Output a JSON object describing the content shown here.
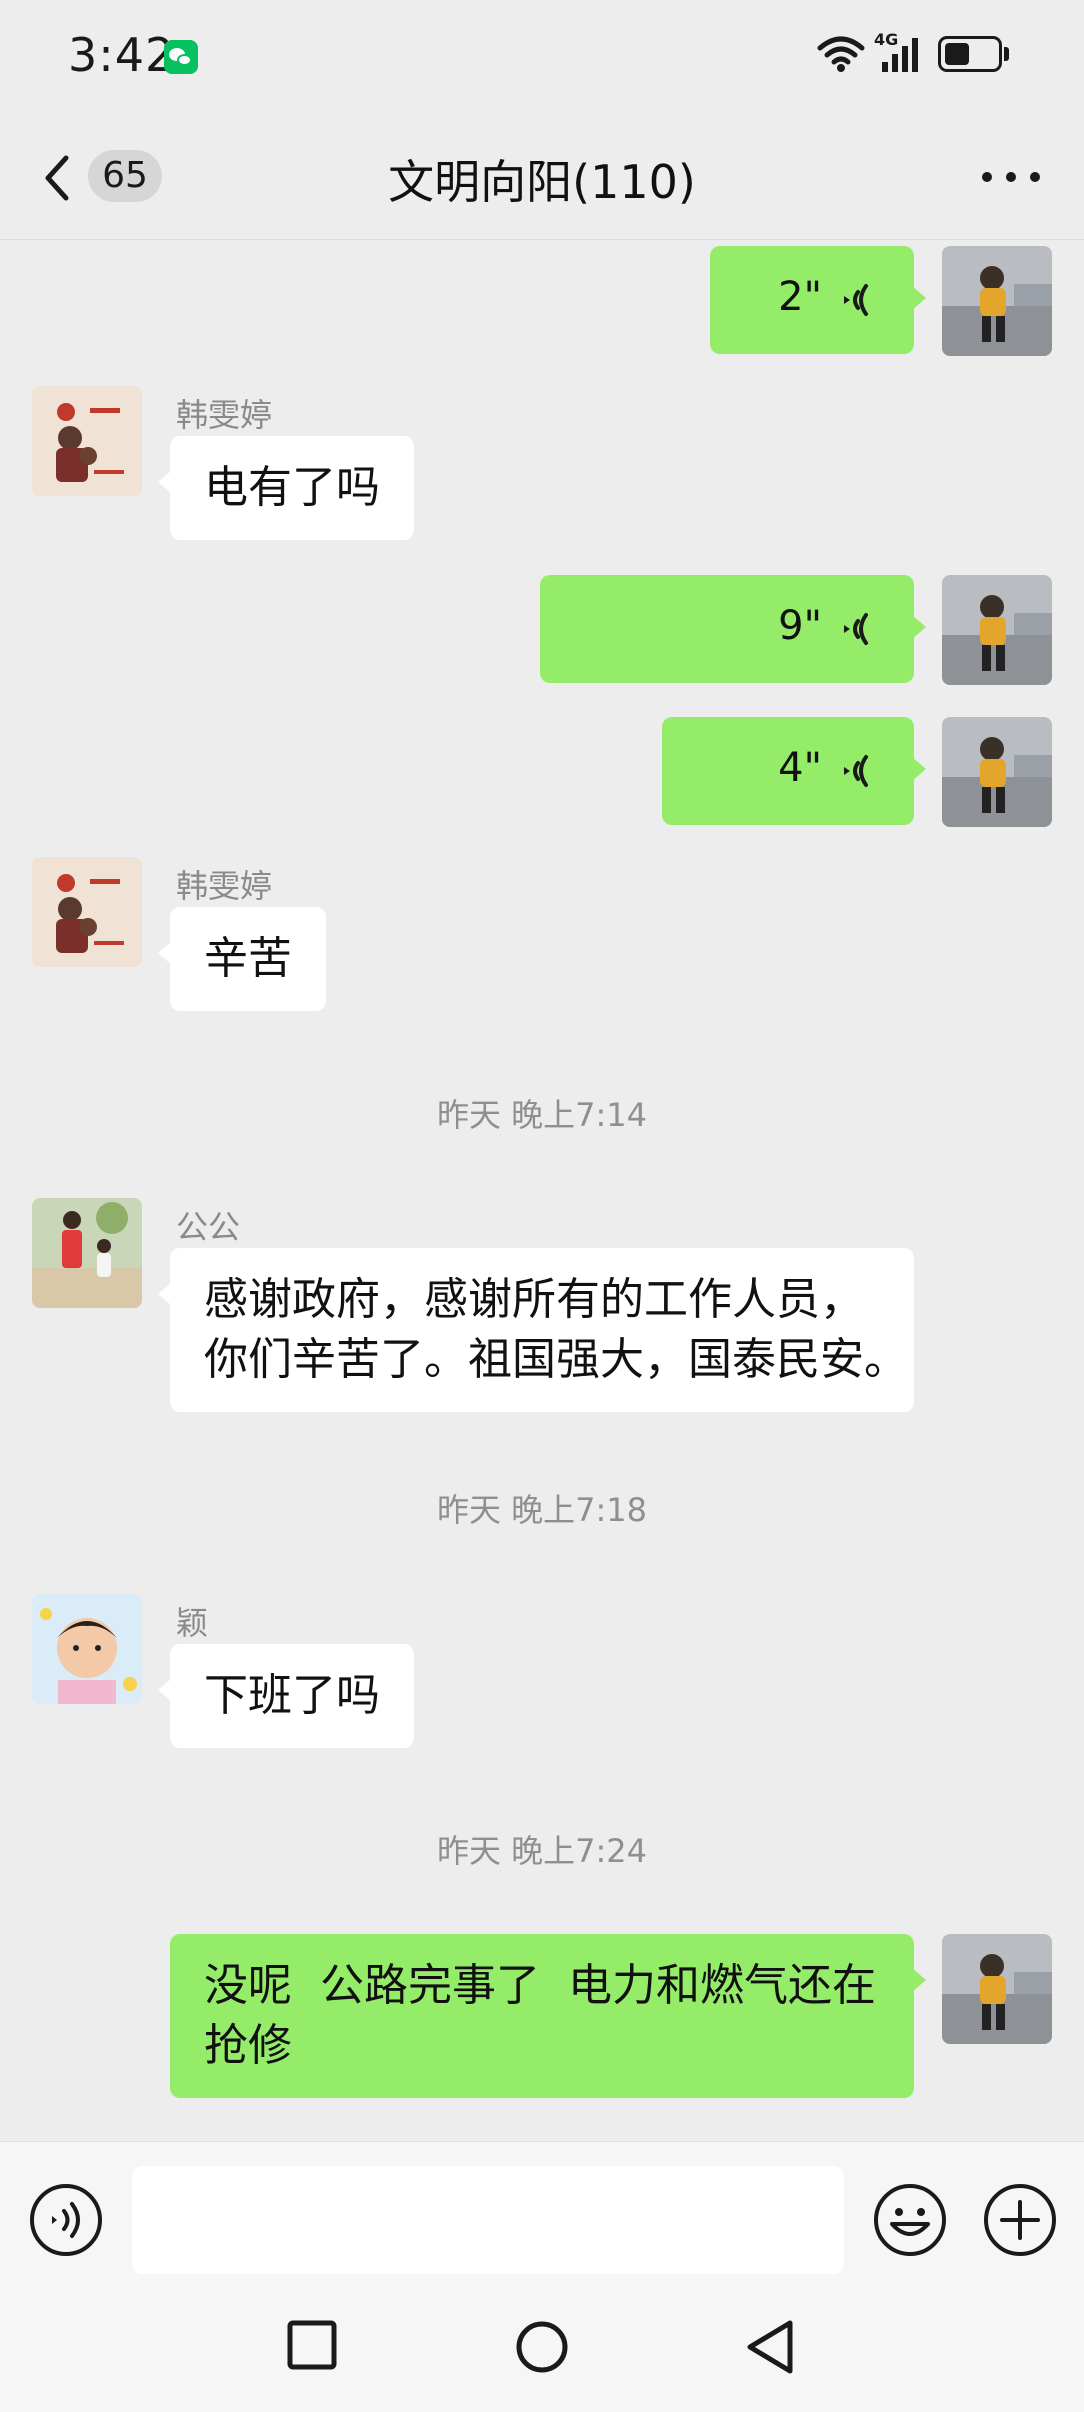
{
  "status_bar": {
    "time": "3:42",
    "network": "4G"
  },
  "header": {
    "unread_count": "65",
    "title": "文明向阳(110)"
  },
  "messages": [
    {
      "type": "voice",
      "direction": "out",
      "duration": "2\""
    },
    {
      "type": "text",
      "direction": "in",
      "sender": "韩雯婷",
      "text": "电有了吗"
    },
    {
      "type": "voice",
      "direction": "out",
      "duration": "9\""
    },
    {
      "type": "voice",
      "direction": "out",
      "duration": "4\""
    },
    {
      "type": "text",
      "direction": "in",
      "sender": "韩雯婷",
      "text": "辛苦"
    },
    {
      "type": "timestamp",
      "text": "昨天 晚上7:14"
    },
    {
      "type": "text",
      "direction": "in",
      "sender": "公公",
      "line1": "感谢政府，感谢所有的工作人员，",
      "line2": "你们辛苦了。祖国强大，国泰民安。"
    },
    {
      "type": "timestamp",
      "text": "昨天 晚上7:18"
    },
    {
      "type": "text",
      "direction": "in",
      "sender": "颖",
      "text": "下班了吗"
    },
    {
      "type": "timestamp",
      "text": "昨天 晚上7:24"
    },
    {
      "type": "text",
      "direction": "out",
      "line1": "没呢  公路完事了  电力和燃气还在",
      "line2": "抢修"
    }
  ],
  "input": {
    "value": "",
    "placeholder": ""
  },
  "colors": {
    "background": "#ededed",
    "outgoing_bubble": "#95ec69",
    "incoming_bubble": "#ffffff",
    "wechat_green": "#07c160"
  },
  "icons": {
    "back": "chevron-left-icon",
    "more": "more-dots-icon",
    "voice_wave": "voice-wave-icon",
    "voice_toggle": "voice-input-icon",
    "emoji": "emoji-icon",
    "plus": "plus-icon",
    "sys_recent": "square-icon",
    "sys_home": "circle-icon",
    "sys_back": "triangle-back-icon"
  }
}
